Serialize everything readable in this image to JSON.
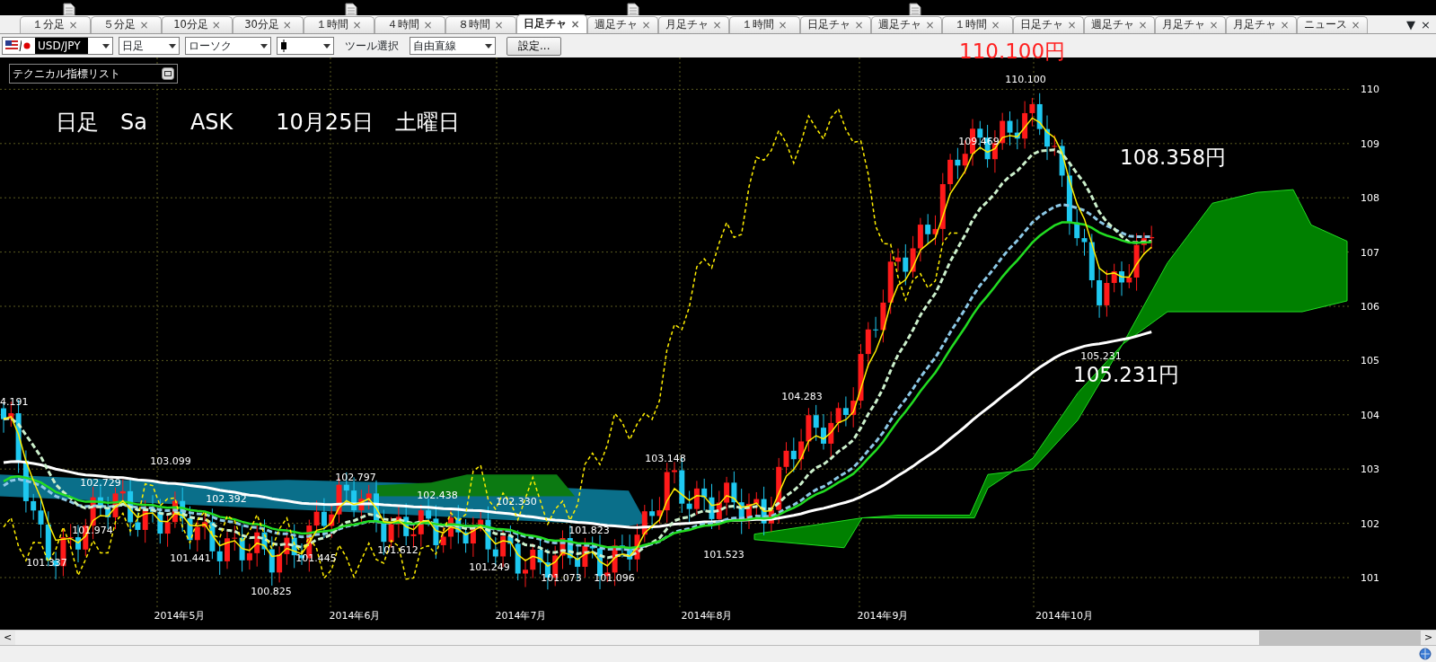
{
  "tabs": [
    {
      "label": "１分足",
      "selected": false
    },
    {
      "label": "５分足",
      "selected": false
    },
    {
      "label": "10分足",
      "selected": false
    },
    {
      "label": "30分足",
      "selected": false
    },
    {
      "label": "１時間",
      "selected": false
    },
    {
      "label": "４時間",
      "selected": false
    },
    {
      "label": "８時間",
      "selected": false
    },
    {
      "label": "日足チャ",
      "selected": true
    },
    {
      "label": "週足チャ",
      "selected": false
    },
    {
      "label": "月足チャ",
      "selected": false
    },
    {
      "label": "１時間",
      "selected": false
    },
    {
      "label": "日足チャ",
      "selected": false
    },
    {
      "label": "週足チャ",
      "selected": false
    },
    {
      "label": "１時間",
      "selected": false
    },
    {
      "label": "日足チャ",
      "selected": false
    },
    {
      "label": "週足チャ",
      "selected": false
    },
    {
      "label": "月足チャ",
      "selected": false
    },
    {
      "label": "月足チャ",
      "selected": false
    },
    {
      "label": "ニュース",
      "selected": false
    }
  ],
  "tab_close_glyph": "×",
  "tab_controls": [
    {
      "glyph": "▼"
    },
    {
      "glyph": "×"
    }
  ],
  "toolbar": {
    "symbol": "USD/JPY",
    "timeframe": "日足",
    "chart_type": "ローソク",
    "tool_label": "ツール選択",
    "tool": "自由直線",
    "settings_button": "設定..."
  },
  "indicator_panel": {
    "title": "テクニカル指標リスト"
  },
  "chart": {
    "overlay_title": "日足　Sa　　ASK　　10月25日　土曜日",
    "callouts": [
      {
        "text": "110.100円",
        "color": "#ff2020"
      },
      {
        "text": "108.358円",
        "color": "#ffffff"
      },
      {
        "text": "105.231円",
        "color": "#ffffff"
      }
    ],
    "price_labels": [
      "4.191",
      "103.099",
      "102.729",
      "102.392",
      "101.974",
      "101.337",
      "101.441",
      "100.825",
      "102.797",
      "101.445",
      "102.438",
      "101.612",
      "102.330",
      "101.823",
      "101.249",
      "101.073",
      "101.096",
      "103.148",
      "101.523",
      "104.283",
      "109.469",
      "110.100",
      "105.231"
    ],
    "y_axis": [
      "110",
      "109",
      "108",
      "107",
      "106",
      "105",
      "104",
      "103",
      "102",
      "101"
    ],
    "x_axis": [
      "2014年5月",
      "2014年6月",
      "2014年7月",
      "2014年8月",
      "2014年9月",
      "2014年10月"
    ]
  },
  "scrollbar": {
    "left": "<",
    "right": ">"
  }
}
